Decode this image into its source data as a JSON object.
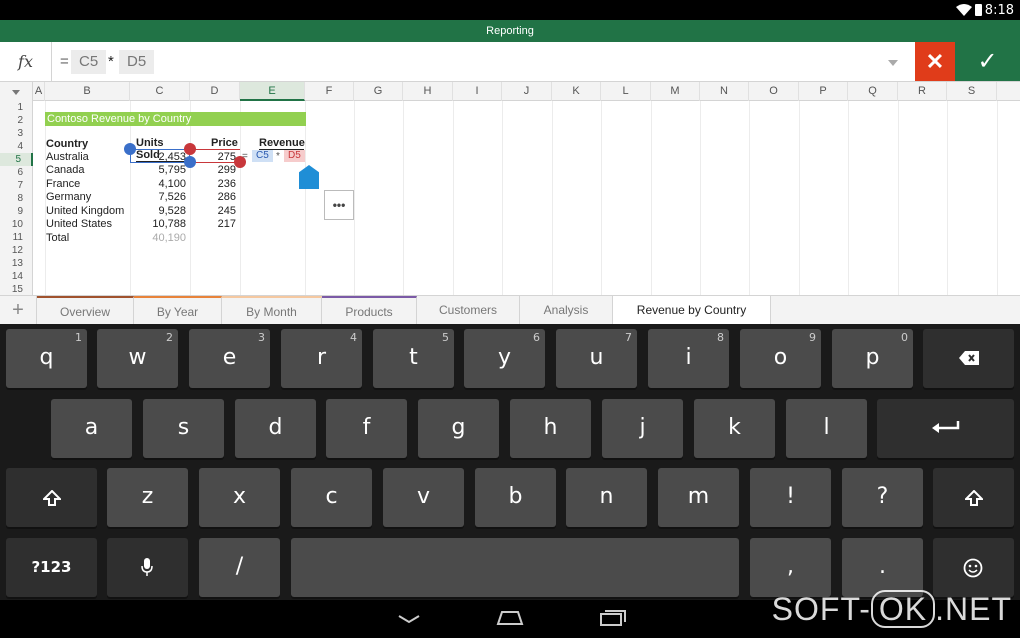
{
  "status": {
    "time": "8:18",
    "wifi_icon": "wifi-icon",
    "battery_icon": "battery-icon"
  },
  "app": {
    "title": "Reporting",
    "brand_color": "#217346"
  },
  "formula_bar": {
    "fx_label": "fx",
    "tokens": [
      "=",
      "C5",
      "*",
      "D5"
    ],
    "cancel_icon": "close-icon",
    "confirm_icon": "checkmark-icon"
  },
  "sheet": {
    "columns": [
      "A",
      "B",
      "C",
      "D",
      "E",
      "F",
      "G",
      "H",
      "I",
      "J",
      "K",
      "L",
      "M",
      "N",
      "O",
      "P",
      "Q",
      "R",
      "S"
    ],
    "selected_column": "E",
    "rows": [
      "1",
      "2",
      "3",
      "4",
      "5",
      "6",
      "7",
      "8",
      "9",
      "10",
      "11",
      "12",
      "13",
      "14",
      "15"
    ],
    "selected_row": "5",
    "title": "Contoso Revenue by Country",
    "headers": {
      "country": "Country",
      "units": "Units Sold",
      "price": "Price",
      "revenue": "Revenue"
    },
    "data": [
      {
        "country": "Australia",
        "units": "2,453",
        "price": "275"
      },
      {
        "country": "Canada",
        "units": "5,795",
        "price": "299"
      },
      {
        "country": "France",
        "units": "4,100",
        "price": "236"
      },
      {
        "country": "Germany",
        "units": "7,526",
        "price": "286"
      },
      {
        "country": "United Kingdom",
        "units": "9,528",
        "price": "245"
      },
      {
        "country": "United States",
        "units": "10,788",
        "price": "217"
      }
    ],
    "total_label": "Total",
    "total_units": "40,190",
    "edit_formula": {
      "eq": "=",
      "ref1": "C5",
      "op": "*",
      "ref2": "D5"
    },
    "more_button": "•••"
  },
  "tabs": {
    "add_label": "+",
    "items": [
      "Overview",
      "By Year",
      "By Month",
      "Products",
      "Customers",
      "Analysis",
      "Revenue by Country"
    ],
    "active": "Revenue by Country"
  },
  "keyboard": {
    "row1": [
      {
        "k": "q",
        "n": "1"
      },
      {
        "k": "w",
        "n": "2"
      },
      {
        "k": "e",
        "n": "3"
      },
      {
        "k": "r",
        "n": "4"
      },
      {
        "k": "t",
        "n": "5"
      },
      {
        "k": "y",
        "n": "6"
      },
      {
        "k": "u",
        "n": "7"
      },
      {
        "k": "i",
        "n": "8"
      },
      {
        "k": "o",
        "n": "9"
      },
      {
        "k": "p",
        "n": "0"
      }
    ],
    "row2": [
      "a",
      "s",
      "d",
      "f",
      "g",
      "h",
      "j",
      "k",
      "l"
    ],
    "row3": [
      "z",
      "x",
      "c",
      "v",
      "b",
      "n",
      "m",
      "!",
      "?"
    ],
    "symbols_label": "?123",
    "slash": "/",
    "comma": ",",
    "period": ".",
    "backspace_icon": "backspace-icon",
    "enter_icon": "enter-icon",
    "shift_icon": "shift-icon",
    "mic_icon": "microphone-icon",
    "emoji_icon": "emoji-icon"
  },
  "watermark": {
    "left": "SOFT-",
    "ok": "OK",
    "right": ".NET"
  }
}
